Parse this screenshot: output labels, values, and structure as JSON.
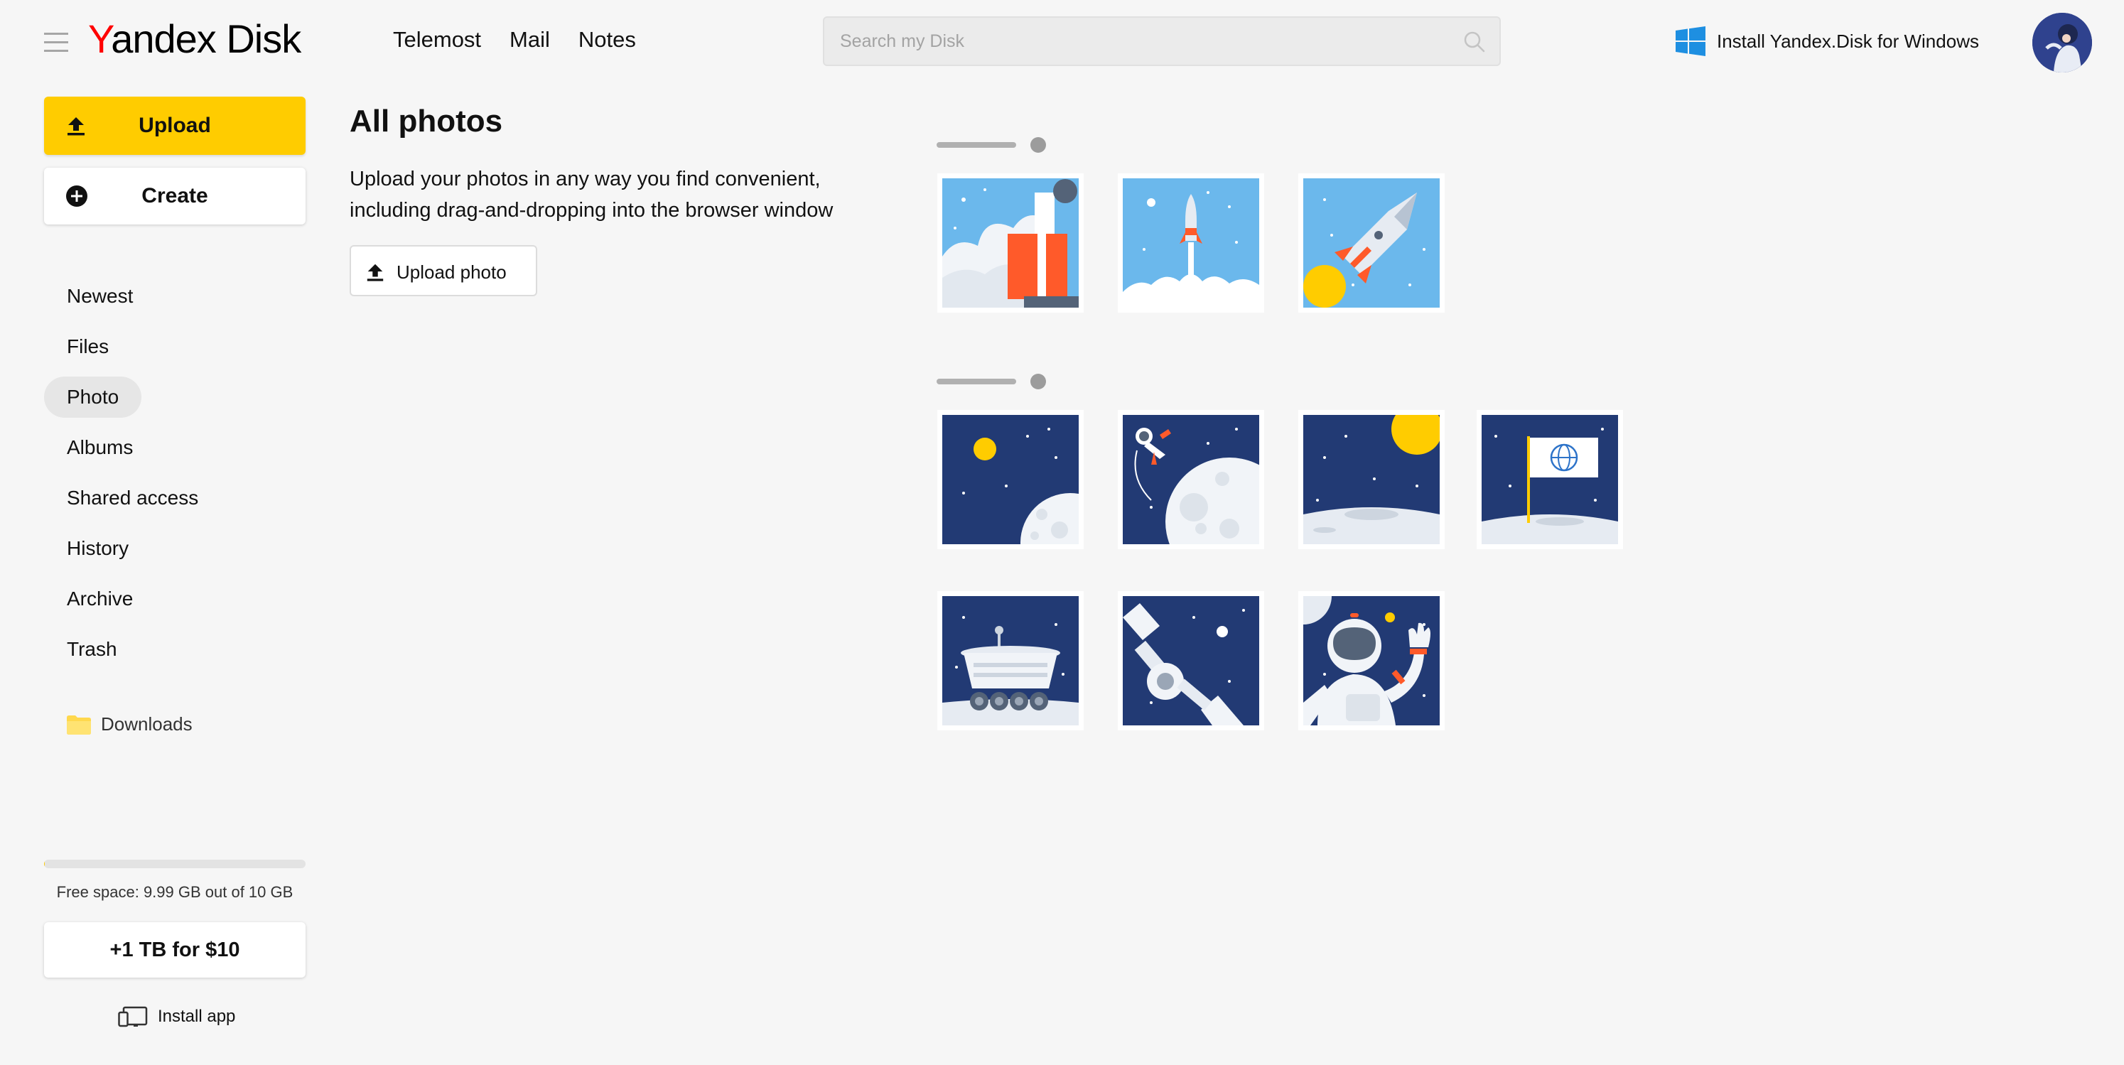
{
  "header": {
    "logo_letter": "Y",
    "logo_brand": "andex",
    "logo_product": "Disk",
    "nav": [
      "Telemost",
      "Mail",
      "Notes"
    ],
    "search_placeholder": "Search my Disk",
    "install_promo": "Install Yandex.Disk for Windows"
  },
  "sidebar": {
    "upload_label": "Upload",
    "create_label": "Create",
    "nav_items": [
      {
        "label": "Newest",
        "active": false
      },
      {
        "label": "Files",
        "active": false
      },
      {
        "label": "Photo",
        "active": true
      },
      {
        "label": "Albums",
        "active": false
      },
      {
        "label": "Shared access",
        "active": false
      },
      {
        "label": "History",
        "active": false
      },
      {
        "label": "Archive",
        "active": false
      },
      {
        "label": "Trash",
        "active": false
      }
    ],
    "downloads_label": "Downloads",
    "storage_used_fraction": 0.001,
    "storage_text": "Free space: 9.99 GB out of 10 GB",
    "upgrade_label": "+1 TB for $10",
    "install_app_label": "Install app"
  },
  "main": {
    "title": "All photos",
    "intro_line1": "Upload your photos in any way you find convenient,",
    "intro_line2": "including drag-and-dropping into the browser window",
    "upload_photo_label": "Upload photo"
  },
  "photo_groups": [
    {
      "photos": [
        "launch-tower",
        "rocket-liftoff",
        "rocket-flight"
      ]
    },
    {
      "photos": [
        "moon-and-sun",
        "astronaut-spacewalk",
        "lunar-horizon",
        "moon-flag",
        "lunar-rover",
        "space-satellite",
        "astronaut-waving"
      ]
    }
  ],
  "colors": {
    "accent_yellow": "#ffcc00",
    "logo_red": "#ff0000",
    "sky_blue": "#6bb8ec",
    "space_navy": "#223a74",
    "rocket_orange": "#ff5a2a"
  }
}
